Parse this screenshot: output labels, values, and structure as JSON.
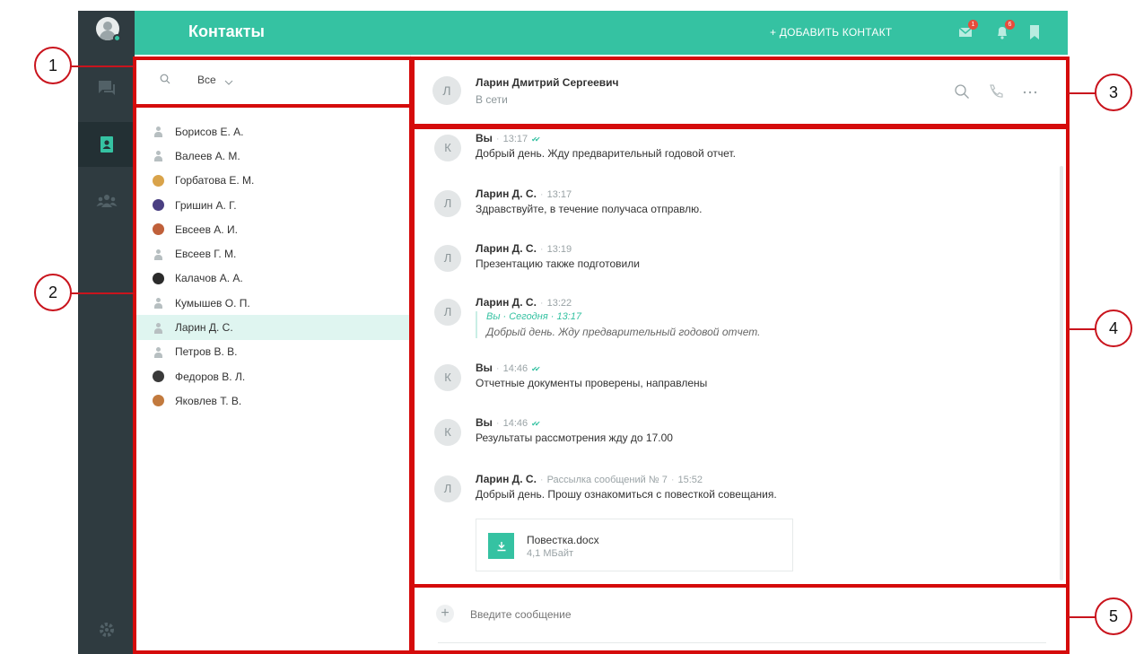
{
  "app": {
    "title": "Контакты",
    "add_contact": "+ ДОБАВИТЬ КОНТАКТ",
    "badges": {
      "messages": "1",
      "notifications": "6"
    }
  },
  "rail": {
    "items": [
      "chats-icon",
      "contacts-icon",
      "groups-icon",
      "settings-icon"
    ],
    "active": "contacts-icon"
  },
  "filter": {
    "label": "Все"
  },
  "contacts": [
    {
      "name": "Борисов Е. А.",
      "avatar": "default"
    },
    {
      "name": "Валеев А. М.",
      "avatar": "default"
    },
    {
      "name": "Горбатова Е. М.",
      "avatar": "photo"
    },
    {
      "name": "Гришин А. Г.",
      "avatar": "photo"
    },
    {
      "name": "Евсеев А. И.",
      "avatar": "photo"
    },
    {
      "name": "Евсеев Г. М.",
      "avatar": "default"
    },
    {
      "name": "Калачов А. А.",
      "avatar": "photo"
    },
    {
      "name": "Кумышев О. П.",
      "avatar": "default"
    },
    {
      "name": "Ларин Д. С.",
      "avatar": "default",
      "selected": true
    },
    {
      "name": "Петров В. В.",
      "avatar": "default"
    },
    {
      "name": "Федоров В. Л.",
      "avatar": "photo"
    },
    {
      "name": "Яковлев Т. В.",
      "avatar": "photo"
    }
  ],
  "conversation": {
    "avatar_letter": "Л",
    "name": "Ларин Дмитрий Сергеевич",
    "status": "В сети"
  },
  "messages": [
    {
      "avatar": "К",
      "author": "Вы",
      "time": "13:17",
      "read": true,
      "text": "Добрый день. Жду предварительный годовой отчет."
    },
    {
      "avatar": "Л",
      "author": "Ларин Д. С.",
      "time": "13:17",
      "text": "Здравствуйте, в течение получаса отправлю."
    },
    {
      "avatar": "Л",
      "author": "Ларин Д. С.",
      "time": "13:19",
      "text": "Презентацию также подготовили"
    },
    {
      "avatar": "Л",
      "author": "Ларин Д. С.",
      "time": "13:22",
      "quote_meta": "Вы · Сегодня · 13:17",
      "quote_text": "Добрый день. Жду предварительный годовой отчет."
    },
    {
      "avatar": "К",
      "author": "Вы",
      "time": "14:46",
      "read": true,
      "text": "Отчетные документы проверены, направлены"
    },
    {
      "avatar": "К",
      "author": "Вы",
      "time": "14:46",
      "read": true,
      "text": "Результаты рассмотрения жду до 17.00"
    },
    {
      "avatar": "Л",
      "author": "Ларин Д. С.",
      "mailing": "Рассылка сообщений № 7",
      "time": "15:52",
      "text": "Добрый день. Прошу ознакомиться с повесткой совещания."
    }
  ],
  "attachment": {
    "name": "Повестка.docx",
    "size": "4,1 МБайт"
  },
  "composer": {
    "placeholder": "Введите сообщение"
  },
  "annotations": [
    "1",
    "2",
    "3",
    "4",
    "5"
  ],
  "colors": {
    "accent": "#35c2a2",
    "rail": "#2f3b40",
    "highlight": "#d50b0b"
  }
}
